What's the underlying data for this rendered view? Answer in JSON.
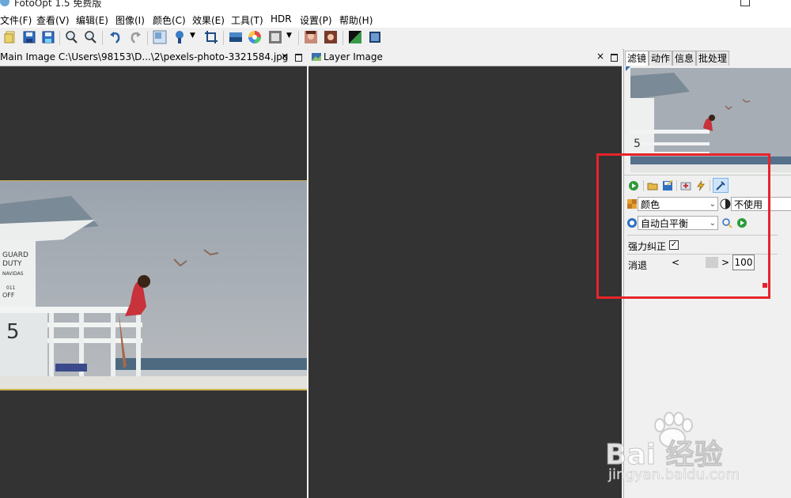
{
  "window": {
    "title": "FotoOpt 1.5 免费版"
  },
  "menu": [
    "文件(F)",
    "查看(V)",
    "编辑(E)",
    "图像(I)",
    "颜色(C)",
    "效果(E)",
    "工具(T)",
    "HDR",
    "设置(P)",
    "帮助(H)"
  ],
  "toolbar_icons": [
    "open-icon",
    "save-icon",
    "save-as-icon",
    "zoom-in-icon",
    "zoom-out-icon",
    "undo-icon",
    "redo-icon",
    "resize-icon",
    "brush-icon",
    "crop-icon",
    "gradient-icon",
    "color-wheel-icon",
    "frame-icon",
    "portrait-icon",
    "portrait-icon-2",
    "levels-icon",
    "image-icon"
  ],
  "main_tab": {
    "title": "Main Image C:\\Users\\98153\\D...\\2\\pexels-photo-3321584.jpg",
    "close": "×"
  },
  "layer_tab": {
    "title": "Layer Image",
    "close": "×"
  },
  "panel": {
    "tabs": [
      "滤镜",
      "动作",
      "信息",
      "批处理"
    ],
    "combo_type": "颜色",
    "combo_mask": "不使用",
    "combo_filter": "自动白平衡",
    "checkbox_label": "强力纠正",
    "checkbox_checked": true,
    "fade_label": "消退",
    "fade_value": "100",
    "slider_left": "<",
    "slider_right": ">"
  },
  "watermark": {
    "brand": "Bai 经验",
    "url": "jingyan.baidu.com"
  },
  "colors": {
    "canvas": "#333333",
    "highlight": "#e8232b"
  }
}
